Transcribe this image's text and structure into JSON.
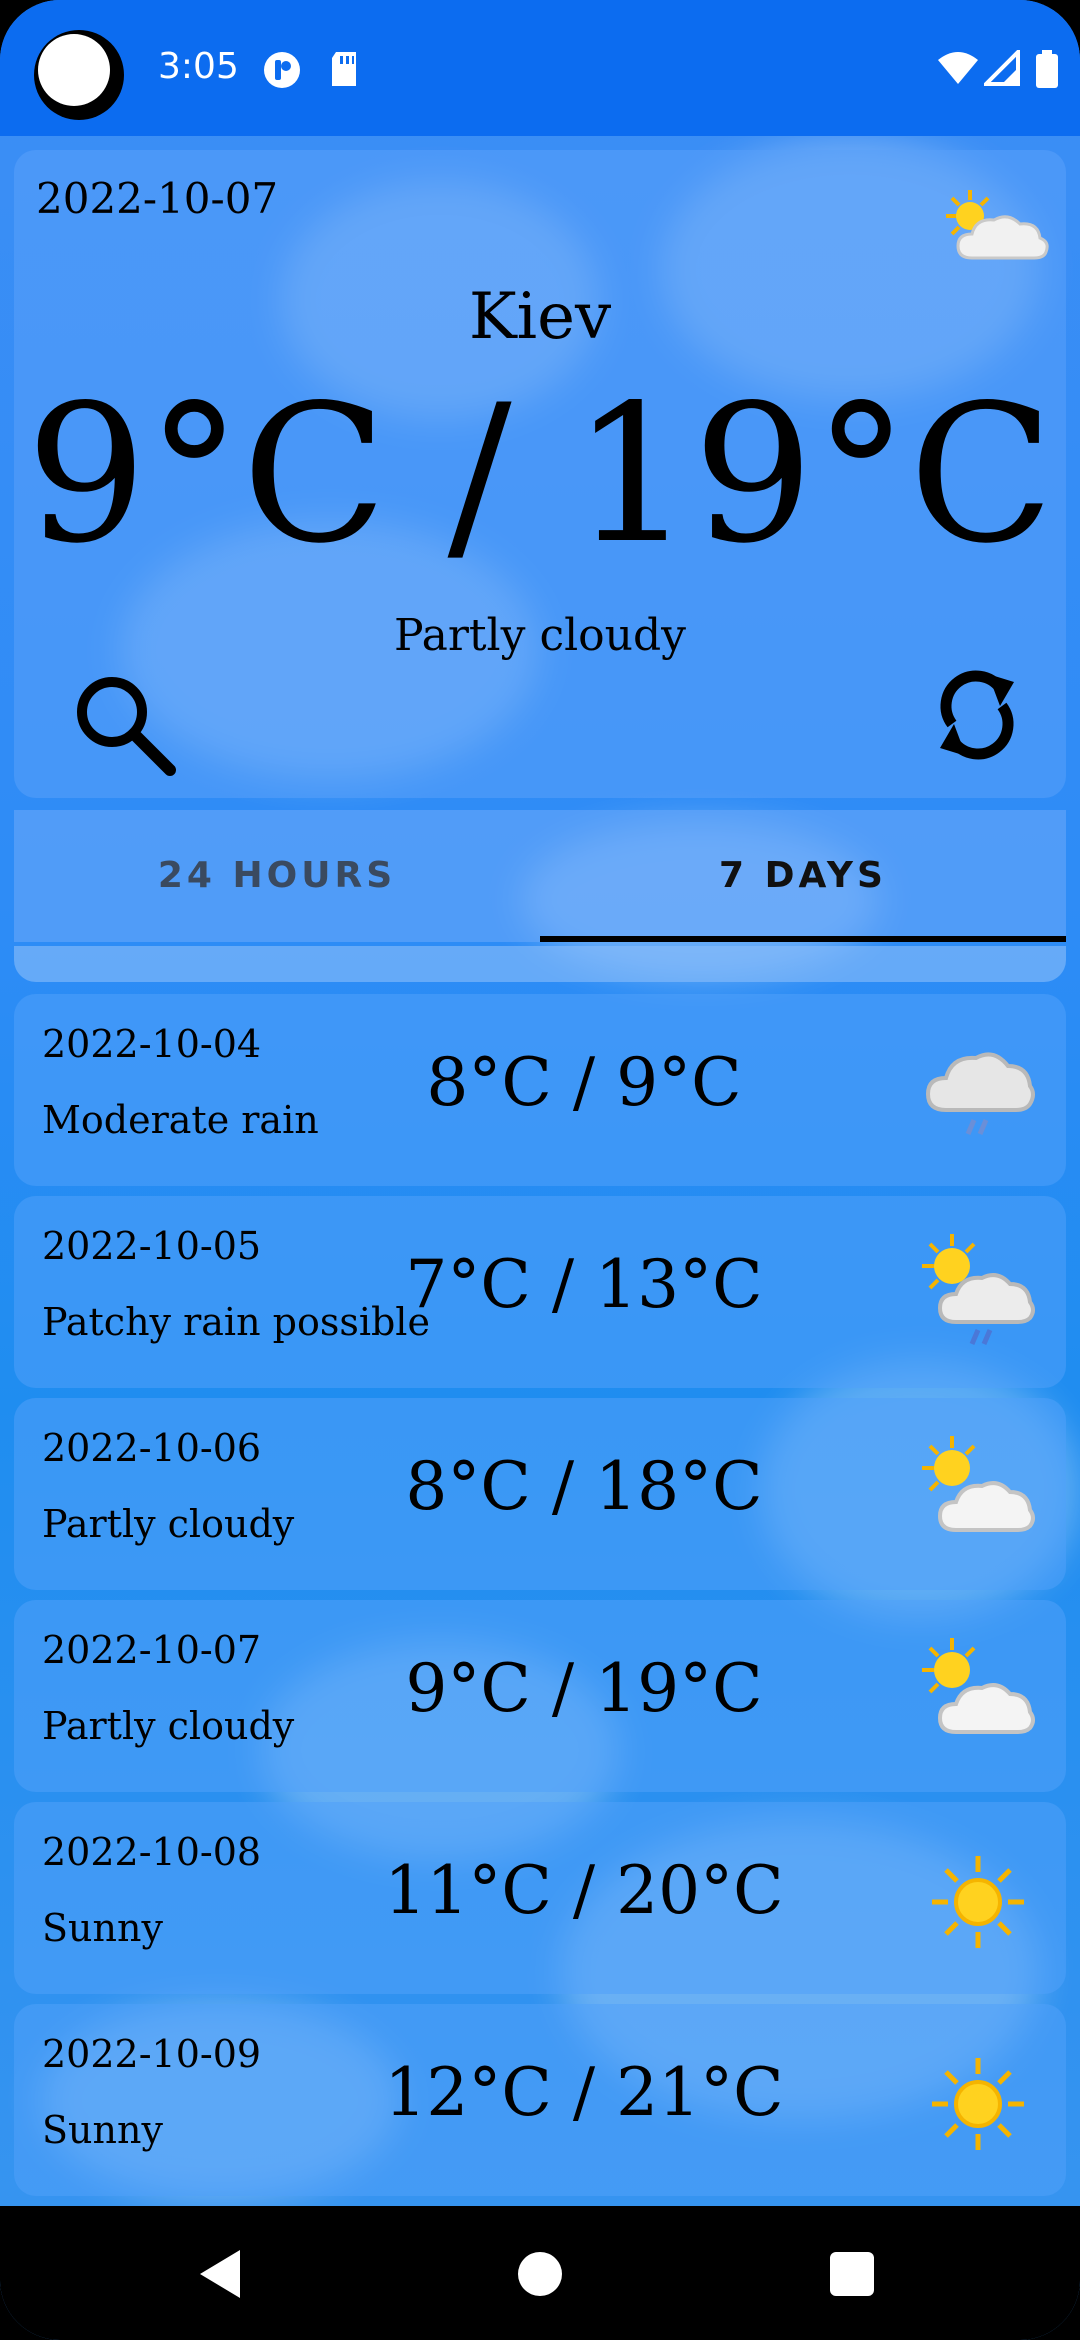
{
  "status_bar": {
    "time": "3:05"
  },
  "current": {
    "date": "2022-10-07",
    "city": "Kiev",
    "temperature": "9°C / 19°C",
    "condition": "Partly cloudy",
    "icon": "partly-cloudy-icon"
  },
  "tabs": [
    {
      "label": "24 HOURS",
      "selected": false
    },
    {
      "label": "7 DAYS",
      "selected": true
    }
  ],
  "forecast": [
    {
      "date": "2022-10-04",
      "condition": "Moderate rain",
      "temperature": "8°C / 9°C",
      "icon": "rain-cloud-icon"
    },
    {
      "date": "2022-10-05",
      "condition": "Patchy rain possible",
      "temperature": "7°C / 13°C",
      "icon": "sun-rain-icon"
    },
    {
      "date": "2022-10-06",
      "condition": "Partly cloudy",
      "temperature": "8°C / 18°C",
      "icon": "partly-cloudy-icon"
    },
    {
      "date": "2022-10-07",
      "condition": "Partly cloudy",
      "temperature": "9°C / 19°C",
      "icon": "partly-cloudy-icon"
    },
    {
      "date": "2022-10-08",
      "condition": "Sunny",
      "temperature": "11°C / 20°C",
      "icon": "sun-icon"
    },
    {
      "date": "2022-10-09",
      "condition": "Sunny",
      "temperature": "12°C / 21°C",
      "icon": "sun-icon"
    }
  ],
  "colors": {
    "status_bar": "#0c6cf0",
    "sky": "#2d8cf6"
  }
}
